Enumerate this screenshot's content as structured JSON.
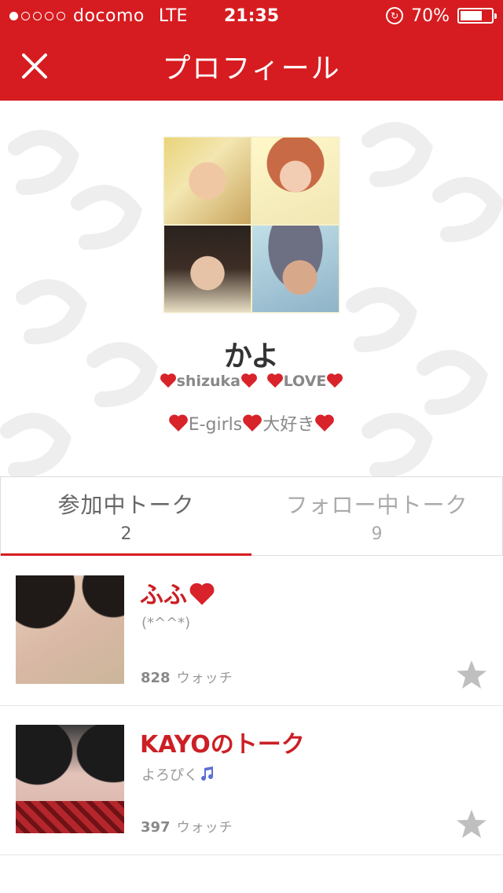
{
  "status_bar": {
    "carrier": "docomo",
    "network": "LTE",
    "time": "21:35",
    "battery": "70%",
    "battery_level": 0.7,
    "signal_bars_filled": 1,
    "signal_bars_total": 5
  },
  "header": {
    "title": "プロフィール",
    "close_icon": "close-icon",
    "color": "#d61c20"
  },
  "profile": {
    "name": "かよ",
    "tagline_parts": [
      "shizuka",
      "LOVE"
    ],
    "bio_parts": [
      "E-girls",
      "大好き"
    ]
  },
  "tabs": [
    {
      "label": "参加中トーク",
      "count": "2",
      "active": true
    },
    {
      "label": "フォロー中トーク",
      "count": "9",
      "active": false
    }
  ],
  "talks": [
    {
      "title": "ふふ",
      "title_suffix_icon": "heart-icon",
      "subtitle": "(*^^*)",
      "watch_count": "828",
      "watch_label": "ウォッチ",
      "star_icon": "star-icon"
    },
    {
      "title": "KAYOのトーク",
      "subtitle": "よろぴく",
      "subtitle_suffix_icon": "music-note-icon",
      "watch_count": "397",
      "watch_label": "ウォッチ",
      "star_icon": "star-icon"
    }
  ],
  "colors": {
    "accent": "#d61c20",
    "title_red": "#cc1f25",
    "star_gray": "#bfbfbf"
  }
}
